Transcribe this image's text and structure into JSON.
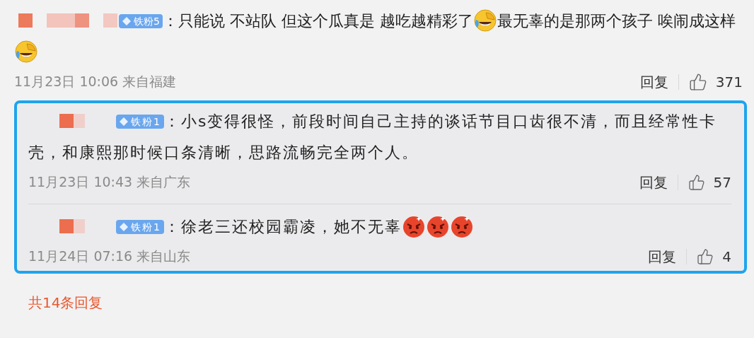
{
  "comment": {
    "badge": "铁粉5",
    "segments": [
      {
        "kind": "text",
        "text": "：只能说 不站队 但这个瓜真是 越吃越精彩了"
      },
      {
        "kind": "laugh"
      },
      {
        "kind": "text",
        "text": "最无辜的是那两个孩子 唉"
      },
      {
        "kind": "text",
        "text": "闹成这样"
      },
      {
        "kind": "laugh"
      }
    ],
    "time": "11月23日 10:06 来自福建",
    "reply": "回复",
    "likes": "371"
  },
  "replies": [
    {
      "badge": "铁粉1",
      "segments": [
        {
          "kind": "text",
          "text": "：小s变得很怪，前段时间自己主持的谈话节目口齿很不清，而且经常性卡"
        },
        {
          "kind": "text",
          "text": "壳，和康熙那时候口条清晰，思路流畅完全两个人。"
        }
      ],
      "time": "11月23日 10:43 来自广东",
      "reply": "回复",
      "likes": "57"
    },
    {
      "badge": "铁粉1",
      "segments": [
        {
          "kind": "text",
          "text": "：徐老三还校园霸凌，她不无辜"
        },
        {
          "kind": "angry"
        },
        {
          "kind": "angry"
        },
        {
          "kind": "angry"
        }
      ],
      "time": "11月24日 07:16 来自山东",
      "reply": "回复",
      "likes": "4"
    }
  ],
  "more": "共14条回复"
}
